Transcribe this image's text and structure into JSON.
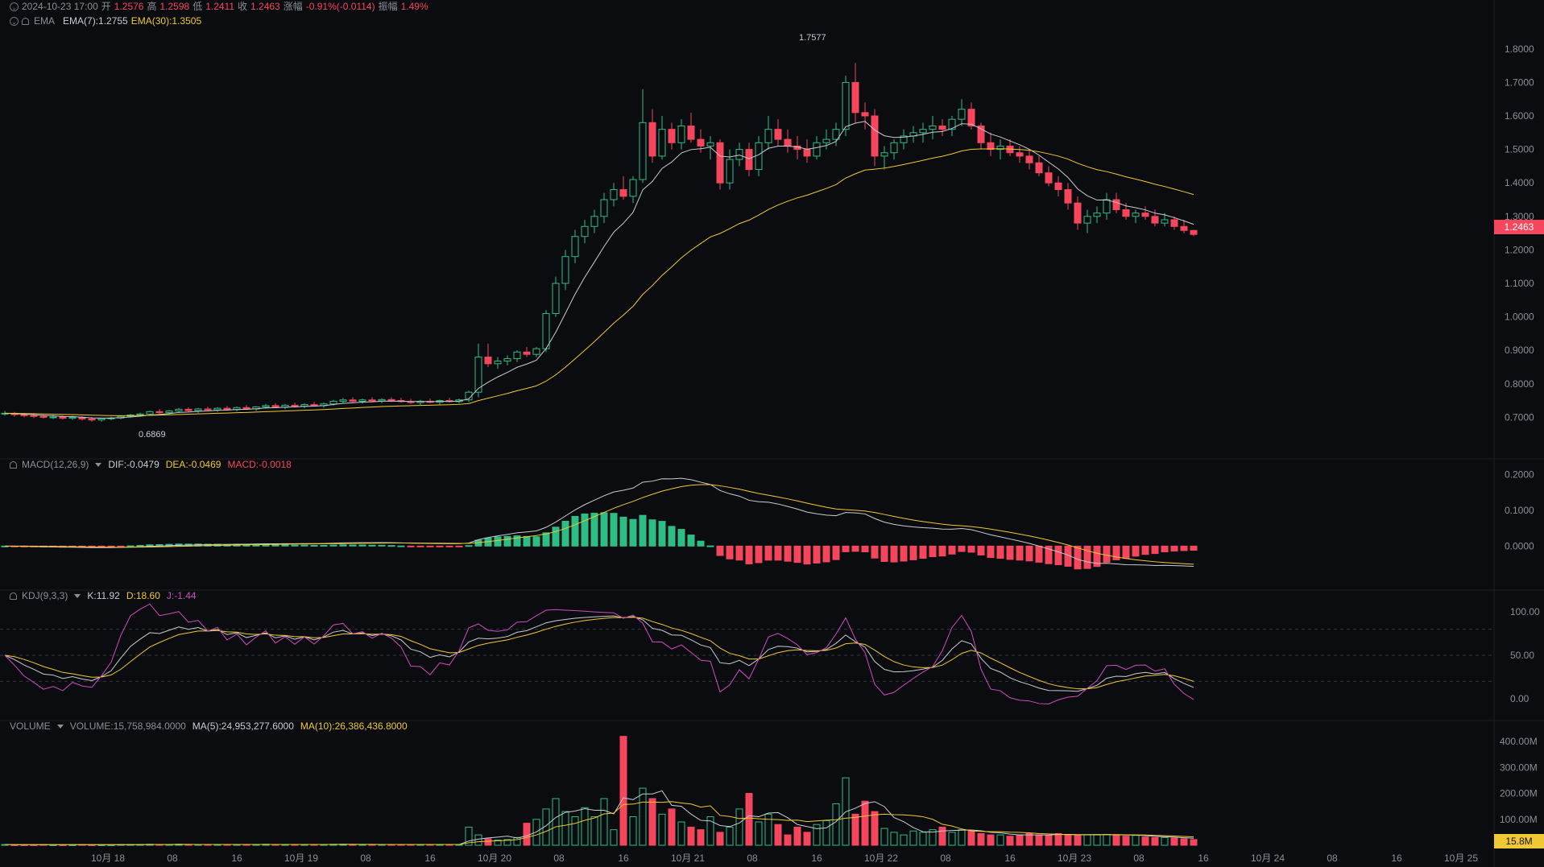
{
  "header": {
    "datetime": "2024-10-23 17:00",
    "open_label": "开",
    "open": "1.2576",
    "high_label": "高",
    "high": "1.2598",
    "low_label": "低",
    "low": "1.2411",
    "close_label": "收",
    "close": "1.2463",
    "change_label": "涨幅",
    "change": "-0.91%(-0.0114)",
    "amp_label": "振幅",
    "amp": "1.49%"
  },
  "ema": {
    "name": "EMA",
    "ema7": "EMA(7):1.2755",
    "ema30": "EMA(30):1.3505"
  },
  "macd": {
    "name": "MACD(12,26,9)",
    "dif": "DIF:-0.0479",
    "dea": "DEA:-0.0469",
    "macd": "MACD:-0.0018"
  },
  "kdj": {
    "name": "KDJ(9,3,3)",
    "k": "K:11.92",
    "d": "D:18.60",
    "j": "J:-1.44"
  },
  "volume": {
    "name": "VOLUME",
    "vol": "VOLUME:15,758,984.0000",
    "ma5": "MA(5):24,953,277.6000",
    "ma10": "MA(10):26,386,436.8000"
  },
  "price_axis": [
    "1.8000",
    "1.7000",
    "1.6000",
    "1.5000",
    "1.4000",
    "1.3000",
    "1.2000",
    "1.1000",
    "1.0000",
    "0.9000",
    "0.8000",
    "0.7000"
  ],
  "macd_axis": [
    "0.2000",
    "0.1000",
    "0.0000"
  ],
  "kdj_axis": [
    "100.00",
    "50.00",
    "0.00"
  ],
  "vol_axis": [
    "400.00M",
    "300.00M",
    "200.00M",
    "100.00M"
  ],
  "time_axis": [
    "10月 18",
    "08",
    "16",
    "10月 19",
    "08",
    "16",
    "10月 20",
    "08",
    "16",
    "10月 21",
    "08",
    "16",
    "10月 22",
    "08",
    "16",
    "10月 23",
    "08",
    "16",
    "10月 24",
    "08",
    "16",
    "10月 25"
  ],
  "current_price": "1.2463",
  "current_volume": "15.8M",
  "max_label": "1.7577",
  "min_label": "0.6869",
  "colors": {
    "up": "#2ebd85",
    "down": "#f6465d",
    "ema7": "#c8ccd4",
    "ema30": "#f0c934",
    "j": "#d14bc0"
  },
  "chart_data": {
    "type": "candlestick",
    "interval_hours": 2,
    "price_ylim": [
      0.6,
      1.85
    ],
    "candles": [
      [
        0.711,
        0.719,
        0.705,
        0.712
      ],
      [
        0.712,
        0.716,
        0.702,
        0.708
      ],
      [
        0.708,
        0.713,
        0.7,
        0.705
      ],
      [
        0.705,
        0.711,
        0.698,
        0.703
      ],
      [
        0.703,
        0.708,
        0.696,
        0.7
      ],
      [
        0.7,
        0.707,
        0.695,
        0.701
      ],
      [
        0.701,
        0.706,
        0.693,
        0.697
      ],
      [
        0.697,
        0.705,
        0.692,
        0.7
      ],
      [
        0.7,
        0.704,
        0.69,
        0.695
      ],
      [
        0.695,
        0.701,
        0.687,
        0.692
      ],
      [
        0.692,
        0.699,
        0.687,
        0.696
      ],
      [
        0.696,
        0.702,
        0.691,
        0.698
      ],
      [
        0.698,
        0.706,
        0.694,
        0.703
      ],
      [
        0.703,
        0.71,
        0.699,
        0.707
      ],
      [
        0.707,
        0.714,
        0.702,
        0.71
      ],
      [
        0.71,
        0.72,
        0.705,
        0.717
      ],
      [
        0.717,
        0.724,
        0.71,
        0.714
      ],
      [
        0.714,
        0.722,
        0.709,
        0.719
      ],
      [
        0.719,
        0.728,
        0.714,
        0.724
      ],
      [
        0.724,
        0.73,
        0.716,
        0.72
      ],
      [
        0.72,
        0.728,
        0.713,
        0.725
      ],
      [
        0.725,
        0.732,
        0.718,
        0.722
      ],
      [
        0.722,
        0.73,
        0.716,
        0.727
      ],
      [
        0.727,
        0.734,
        0.72,
        0.723
      ],
      [
        0.723,
        0.732,
        0.718,
        0.729
      ],
      [
        0.729,
        0.736,
        0.722,
        0.725
      ],
      [
        0.725,
        0.733,
        0.719,
        0.731
      ],
      [
        0.731,
        0.74,
        0.726,
        0.735
      ],
      [
        0.735,
        0.742,
        0.728,
        0.73
      ],
      [
        0.73,
        0.74,
        0.724,
        0.736
      ],
      [
        0.736,
        0.744,
        0.73,
        0.733
      ],
      [
        0.733,
        0.742,
        0.727,
        0.738
      ],
      [
        0.738,
        0.746,
        0.732,
        0.735
      ],
      [
        0.735,
        0.744,
        0.729,
        0.74
      ],
      [
        0.74,
        0.752,
        0.735,
        0.748
      ],
      [
        0.748,
        0.758,
        0.742,
        0.752
      ],
      [
        0.752,
        0.76,
        0.744,
        0.748
      ],
      [
        0.748,
        0.756,
        0.741,
        0.752
      ],
      [
        0.752,
        0.76,
        0.745,
        0.749
      ],
      [
        0.749,
        0.757,
        0.742,
        0.753
      ],
      [
        0.753,
        0.76,
        0.746,
        0.75
      ],
      [
        0.75,
        0.758,
        0.744,
        0.747
      ],
      [
        0.747,
        0.755,
        0.74,
        0.744
      ],
      [
        0.744,
        0.752,
        0.737,
        0.748
      ],
      [
        0.748,
        0.756,
        0.742,
        0.745
      ],
      [
        0.745,
        0.753,
        0.738,
        0.75
      ],
      [
        0.75,
        0.758,
        0.744,
        0.747
      ],
      [
        0.747,
        0.756,
        0.741,
        0.752
      ],
      [
        0.752,
        0.78,
        0.745,
        0.775
      ],
      [
        0.775,
        0.92,
        0.76,
        0.88
      ],
      [
        0.88,
        0.92,
        0.85,
        0.86
      ],
      [
        0.86,
        0.88,
        0.845,
        0.868
      ],
      [
        0.868,
        0.885,
        0.855,
        0.875
      ],
      [
        0.875,
        0.9,
        0.865,
        0.895
      ],
      [
        0.895,
        0.91,
        0.88,
        0.888
      ],
      [
        0.888,
        0.91,
        0.88,
        0.905
      ],
      [
        0.905,
        1.02,
        0.895,
        1.01
      ],
      [
        1.01,
        1.12,
        1.0,
        1.1
      ],
      [
        1.1,
        1.2,
        1.08,
        1.18
      ],
      [
        1.18,
        1.26,
        1.16,
        1.24
      ],
      [
        1.24,
        1.29,
        1.22,
        1.27
      ],
      [
        1.27,
        1.32,
        1.25,
        1.3
      ],
      [
        1.3,
        1.37,
        1.28,
        1.35
      ],
      [
        1.35,
        1.4,
        1.33,
        1.38
      ],
      [
        1.38,
        1.42,
        1.35,
        1.36
      ],
      [
        1.36,
        1.42,
        1.34,
        1.41
      ],
      [
        1.41,
        1.68,
        1.4,
        1.58
      ],
      [
        1.58,
        1.62,
        1.46,
        1.48
      ],
      [
        1.48,
        1.6,
        1.47,
        1.56
      ],
      [
        1.56,
        1.58,
        1.5,
        1.52
      ],
      [
        1.52,
        1.59,
        1.5,
        1.57
      ],
      [
        1.57,
        1.61,
        1.52,
        1.53
      ],
      [
        1.53,
        1.56,
        1.49,
        1.51
      ],
      [
        1.51,
        1.54,
        1.47,
        1.52
      ],
      [
        1.52,
        1.53,
        1.38,
        1.4
      ],
      [
        1.4,
        1.5,
        1.38,
        1.47
      ],
      [
        1.47,
        1.52,
        1.45,
        1.5
      ],
      [
        1.5,
        1.52,
        1.42,
        1.44
      ],
      [
        1.44,
        1.54,
        1.42,
        1.52
      ],
      [
        1.52,
        1.6,
        1.5,
        1.56
      ],
      [
        1.56,
        1.59,
        1.51,
        1.53
      ],
      [
        1.53,
        1.56,
        1.49,
        1.51
      ],
      [
        1.51,
        1.54,
        1.47,
        1.5
      ],
      [
        1.5,
        1.53,
        1.46,
        1.48
      ],
      [
        1.48,
        1.54,
        1.47,
        1.52
      ],
      [
        1.52,
        1.56,
        1.5,
        1.53
      ],
      [
        1.53,
        1.58,
        1.51,
        1.56
      ],
      [
        1.56,
        1.72,
        1.54,
        1.7
      ],
      [
        1.7,
        1.758,
        1.58,
        1.61
      ],
      [
        1.61,
        1.64,
        1.56,
        1.6
      ],
      [
        1.6,
        1.62,
        1.45,
        1.48
      ],
      [
        1.48,
        1.51,
        1.44,
        1.49
      ],
      [
        1.49,
        1.53,
        1.47,
        1.52
      ],
      [
        1.52,
        1.56,
        1.5,
        1.54
      ],
      [
        1.54,
        1.57,
        1.52,
        1.55
      ],
      [
        1.55,
        1.58,
        1.52,
        1.56
      ],
      [
        1.56,
        1.6,
        1.53,
        1.57
      ],
      [
        1.57,
        1.59,
        1.54,
        1.56
      ],
      [
        1.56,
        1.6,
        1.54,
        1.59
      ],
      [
        1.59,
        1.65,
        1.57,
        1.62
      ],
      [
        1.62,
        1.64,
        1.56,
        1.57
      ],
      [
        1.57,
        1.58,
        1.5,
        1.52
      ],
      [
        1.52,
        1.55,
        1.48,
        1.5
      ],
      [
        1.5,
        1.53,
        1.47,
        1.51
      ],
      [
        1.51,
        1.53,
        1.48,
        1.49
      ],
      [
        1.49,
        1.51,
        1.46,
        1.48
      ],
      [
        1.48,
        1.5,
        1.44,
        1.46
      ],
      [
        1.46,
        1.48,
        1.42,
        1.43
      ],
      [
        1.43,
        1.45,
        1.39,
        1.4
      ],
      [
        1.4,
        1.42,
        1.36,
        1.38
      ],
      [
        1.38,
        1.4,
        1.32,
        1.34
      ],
      [
        1.34,
        1.36,
        1.26,
        1.28
      ],
      [
        1.28,
        1.32,
        1.25,
        1.3
      ],
      [
        1.3,
        1.33,
        1.28,
        1.31
      ],
      [
        1.31,
        1.37,
        1.29,
        1.35
      ],
      [
        1.35,
        1.37,
        1.31,
        1.32
      ],
      [
        1.32,
        1.34,
        1.29,
        1.3
      ],
      [
        1.3,
        1.32,
        1.28,
        1.31
      ],
      [
        1.31,
        1.33,
        1.29,
        1.3
      ],
      [
        1.3,
        1.32,
        1.27,
        1.28
      ],
      [
        1.28,
        1.31,
        1.27,
        1.29
      ],
      [
        1.29,
        1.3,
        1.26,
        1.27
      ],
      [
        1.27,
        1.29,
        1.25,
        1.258
      ],
      [
        1.258,
        1.26,
        1.241,
        1.246
      ]
    ],
    "volumes_m": [
      3,
      2,
      2,
      2,
      3,
      2,
      2,
      2,
      3,
      2,
      2,
      2,
      3,
      3,
      3,
      4,
      3,
      3,
      4,
      3,
      3,
      3,
      3,
      3,
      3,
      3,
      3,
      4,
      3,
      3,
      3,
      3,
      3,
      3,
      4,
      4,
      3,
      3,
      3,
      3,
      3,
      3,
      3,
      3,
      3,
      3,
      3,
      3,
      70,
      40,
      25,
      20,
      22,
      30,
      85,
      100,
      140,
      180,
      130,
      110,
      145,
      110,
      180,
      60,
      420,
      110,
      220,
      180,
      120,
      140,
      90,
      70,
      60,
      110,
      50,
      70,
      140,
      200,
      90,
      120,
      80,
      40,
      70,
      50,
      80,
      95,
      160,
      260,
      120,
      170,
      130,
      65,
      50,
      40,
      55,
      50,
      60,
      70,
      50,
      60,
      55,
      45,
      40,
      40,
      35,
      40,
      45,
      40,
      38,
      45,
      42,
      40,
      40,
      40,
      42,
      40,
      35,
      38,
      32,
      30,
      30,
      28,
      25,
      22,
      24,
      20,
      16
    ]
  }
}
